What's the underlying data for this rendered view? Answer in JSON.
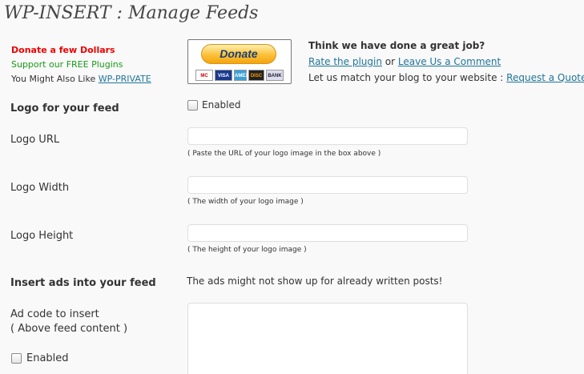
{
  "header": {
    "title": "WP-INSERT : Manage Feeds"
  },
  "donate": {
    "line1": "Donate a few Dollars",
    "line2": "Support our FREE Plugins",
    "line3_prefix": "You Might Also Like",
    "line3_link": "WP-PRIVATE",
    "button_label": "Donate",
    "cards": [
      "MC",
      "VISA",
      "AMEX",
      "DISC",
      "BANK"
    ]
  },
  "promo": {
    "title": "Think we have done a great job?",
    "rate_link": "Rate the plugin",
    "or_text": "or",
    "comment_link": "Leave Us a Comment",
    "match_text": "Let us match your blog to your website :",
    "quote_link": "Request a Quote"
  },
  "logo": {
    "section_label": "Logo for your feed",
    "enabled_label": "Enabled",
    "url_label": "Logo URL",
    "url_value": "",
    "url_hint": "( Paste the URL of your logo image in the box above )",
    "width_label": "Logo Width",
    "width_value": "",
    "width_hint": "( The width of your logo image )",
    "height_label": "Logo Height",
    "height_value": "",
    "height_hint": "( The height of your logo image )"
  },
  "ads": {
    "section_label": "Insert ads into your feed",
    "note": "The ads might not show up for already written posts!",
    "code_label_line1": "Ad code to insert",
    "code_label_line2": "( Above feed content )",
    "enabled_label": "Enabled",
    "code_value": ""
  },
  "colors": {
    "link": "#21759b",
    "donate_red": "#ee0000",
    "donate_green": "#1b9a1b",
    "background": "#f9f9f9"
  }
}
